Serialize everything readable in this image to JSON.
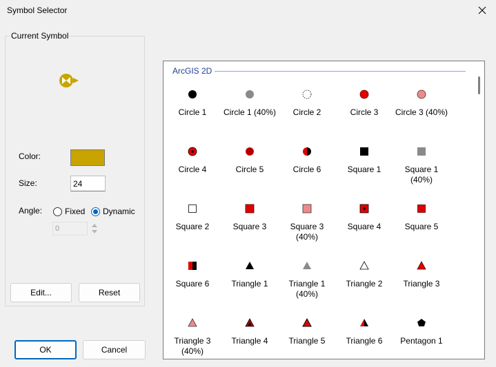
{
  "window": {
    "title": "Symbol Selector"
  },
  "current_symbol": {
    "group_label": "Current Symbol",
    "color_label": "Color:",
    "color_value": "#c9a400",
    "size_label": "Size:",
    "size_value": "24",
    "angle_label": "Angle:",
    "angle_options": [
      "Fixed",
      "Dynamic"
    ],
    "angle_selected": "Dynamic",
    "angle_value": "0"
  },
  "buttons": {
    "edit": "Edit...",
    "reset": "Reset",
    "ok": "OK",
    "cancel": "Cancel"
  },
  "gallery": {
    "category": "ArcGIS 2D",
    "symbols": [
      {
        "name": "Circle 1",
        "icon": "circle-black"
      },
      {
        "name": "Circle 1 (40%)",
        "icon": "circle-gray"
      },
      {
        "name": "Circle 2",
        "icon": "circle-dashed"
      },
      {
        "name": "Circle 3",
        "icon": "circle-red"
      },
      {
        "name": "Circle 3 (40%)",
        "icon": "circle-pink"
      },
      {
        "name": "Circle 4",
        "icon": "circle-red-dot"
      },
      {
        "name": "Circle 5",
        "icon": "circle-red-ring"
      },
      {
        "name": "Circle 6",
        "icon": "circle-half"
      },
      {
        "name": "Square 1",
        "icon": "square-black"
      },
      {
        "name": "Square 1 (40%)",
        "icon": "square-gray"
      },
      {
        "name": "Square 2",
        "icon": "square-hollow"
      },
      {
        "name": "Square 3",
        "icon": "square-red"
      },
      {
        "name": "Square 3 (40%)",
        "icon": "square-pink"
      },
      {
        "name": "Square 4",
        "icon": "square-red-dot"
      },
      {
        "name": "Square 5",
        "icon": "square-red-small"
      },
      {
        "name": "Square 6",
        "icon": "square-half"
      },
      {
        "name": "Triangle 1",
        "icon": "triangle-black"
      },
      {
        "name": "Triangle 1 (40%)",
        "icon": "triangle-gray"
      },
      {
        "name": "Triangle 2",
        "icon": "triangle-hollow"
      },
      {
        "name": "Triangle 3",
        "icon": "triangle-red"
      },
      {
        "name": "Triangle 3 (40%)",
        "icon": "triangle-pink"
      },
      {
        "name": "Triangle 4",
        "icon": "triangle-red-dark"
      },
      {
        "name": "Triangle 5",
        "icon": "triangle-red-outline"
      },
      {
        "name": "Triangle 6",
        "icon": "triangle-half"
      },
      {
        "name": "Pentagon 1",
        "icon": "pentagon-black"
      }
    ]
  }
}
